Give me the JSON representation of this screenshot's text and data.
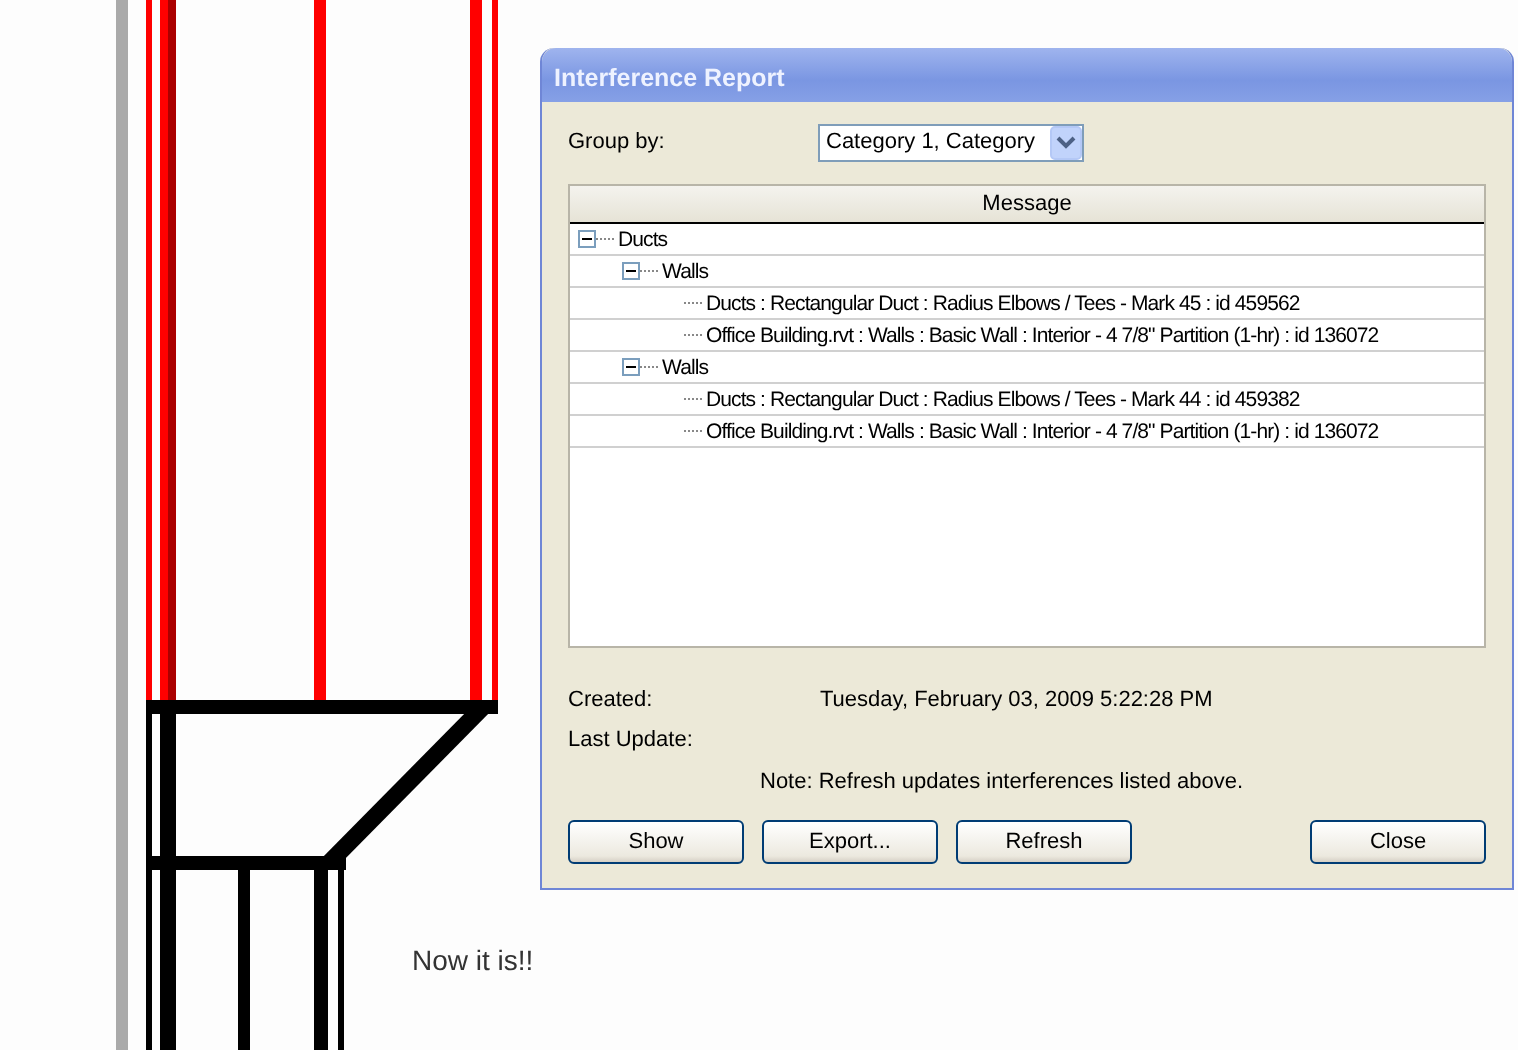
{
  "window": {
    "title": "Interference Report"
  },
  "group_by": {
    "label": "Group by:",
    "value": "Category 1, Category"
  },
  "table": {
    "columns": [
      "Message"
    ],
    "tree": [
      {
        "label": "Ducts",
        "expanded": true,
        "children": [
          {
            "label": "Walls",
            "expanded": true,
            "children": [
              {
                "label": "Ducts : Rectangular Duct : Radius Elbows / Tees - Mark 45 : id 459562"
              },
              {
                "label": "Office Building.rvt : Walls : Basic Wall : Interior - 4 7/8\" Partition (1-hr) : id 136072"
              }
            ]
          },
          {
            "label": "Walls",
            "expanded": true,
            "children": [
              {
                "label": "Ducts : Rectangular Duct : Radius Elbows / Tees - Mark 44 : id 459382"
              },
              {
                "label": "Office Building.rvt : Walls : Basic Wall : Interior - 4 7/8\" Partition (1-hr) : id 136072"
              }
            ]
          }
        ]
      }
    ]
  },
  "info": [
    {
      "label": "Created:",
      "value": "Tuesday, February 03, 2009 5:22:28 PM"
    },
    {
      "label": "Last Update:"
    }
  ],
  "note": "Note: Refresh updates interferences listed above.",
  "buttons_left": [
    "Show",
    "Export...",
    "Refresh"
  ],
  "buttons_right": [
    "Close"
  ],
  "caption": "Now it is!!"
}
